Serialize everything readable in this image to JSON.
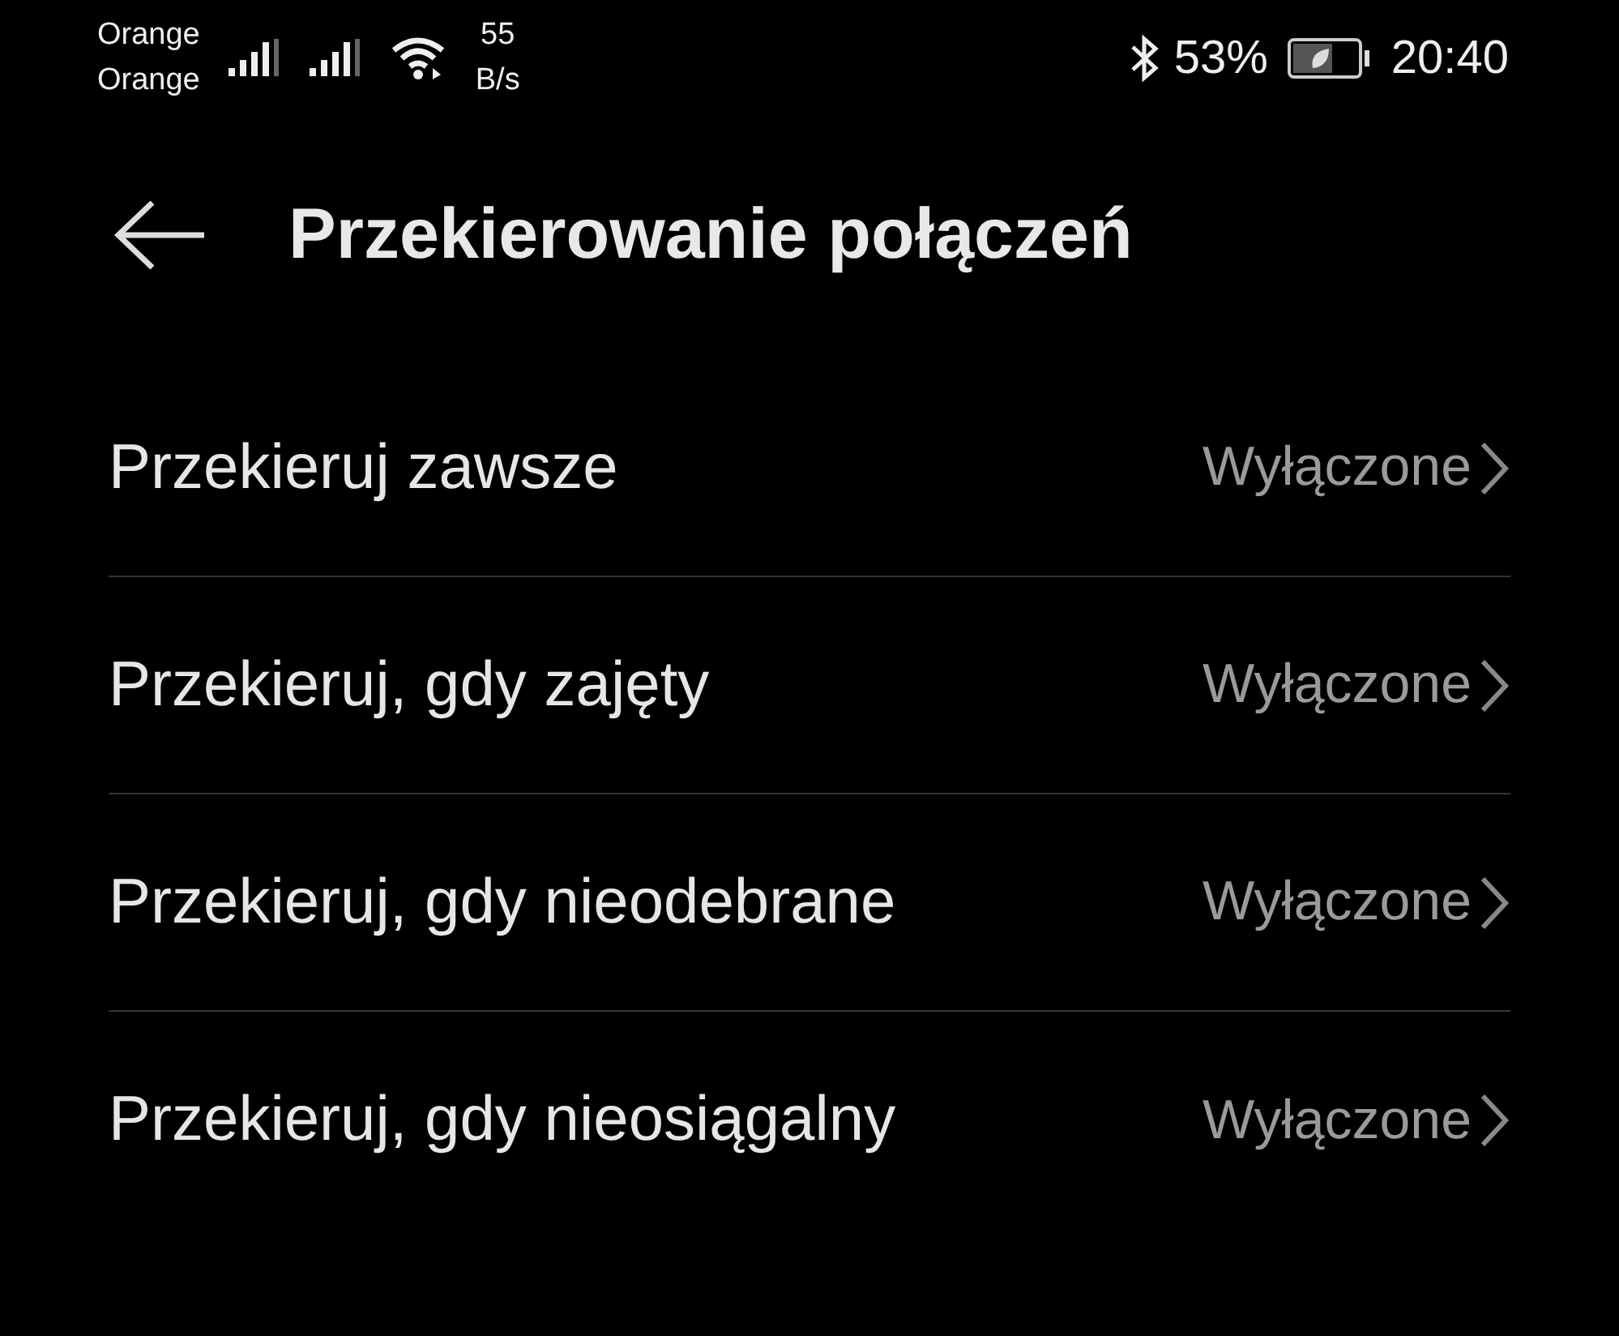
{
  "status_bar": {
    "carriers": [
      "Orange",
      "Orange"
    ],
    "speed_value": "55",
    "speed_unit": "B/s",
    "battery_percent": "53%",
    "time": "20:40"
  },
  "header": {
    "title": "Przekierowanie połączeń"
  },
  "rows": [
    {
      "label": "Przekieruj zawsze",
      "value": "Wyłączone"
    },
    {
      "label": "Przekieruj, gdy zajęty",
      "value": "Wyłączone"
    },
    {
      "label": "Przekieruj, gdy nieodebrane",
      "value": "Wyłączone"
    },
    {
      "label": "Przekieruj, gdy nieosiągalny",
      "value": "Wyłączone"
    }
  ]
}
